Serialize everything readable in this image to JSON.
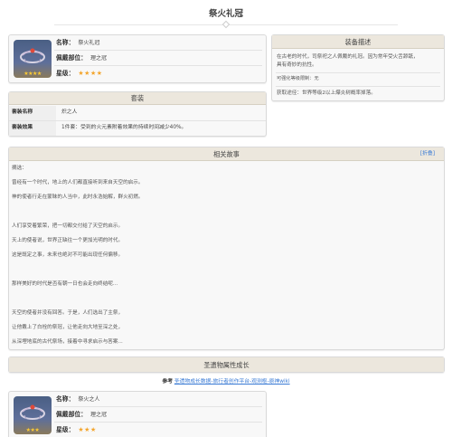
{
  "page": {
    "title": "祭火礼冠"
  },
  "item": {
    "name_label": "名称：",
    "name_value": "祭火礼冠",
    "slot_label": "佩戴部位：",
    "slot_value": "理之冠",
    "rarity_label": "星级：",
    "rarity_stars": "★★★★",
    "icon_stars": "★★★★",
    "icon": "crown-relic-icon"
  },
  "description": {
    "header": "装备描述",
    "text_1": "在古老的时代，司祭祀之人佩戴的礼冠。因为常年受火舌舔舐，",
    "text_2": "具有奇妙的抗性。",
    "max_enhance": "可强化等级限制：无",
    "source": "获取途径：世界等级2以上爆炎树概率掉落。"
  },
  "set": {
    "header": "套装",
    "name_key": "套装名称",
    "name_value": "炽之人",
    "effect_key": "套装效果",
    "effect_value": "1件套：受到的火元素附着效果的持续时间减少40%。"
  },
  "story": {
    "header": "相关故事",
    "edit": "[折叠]",
    "lines": [
      "摘选：",
      "曾经有一个时代，地上的人们都直接听到来自天空的启示。",
      "神的使者行走在蒙昧的人当中，此时永浩始解，群火初燃。",
      "",
      "人们享受着繁荣，把一切都交付给了天空的启示。",
      "天上的使者说，世界正缺往一个更加光明的时代。",
      "这是既定之事，未来也绝对不可能出现任何偏移。",
      "",
      "那样美好的时代是否有朝一日也会走向终结呢...",
      "",
      "天空的使者并没有回答。于是，人们选出了主祭，",
      "让他戴上了白栓的祭冠，让他走向大地至深之处，",
      "从深埋地底的古代祭场，接着中寻求启示与答案..."
    ]
  },
  "growth": {
    "header": "圣遗物属性成长",
    "ref_label": "参考",
    "ref_links": "圣遗物成长数据-旅行者创作平台-观测枢-原神wiki"
  },
  "item2": {
    "name_label": "名称：",
    "name_value": "祭火之人",
    "slot_label": "佩戴部位：",
    "slot_value": "理之冠",
    "rarity_label": "星级：",
    "rarity_stars": "★★★",
    "icon_stars": "★★★",
    "icon": "crown-relic-icon"
  },
  "colors": {
    "link": "#3a7bd5",
    "star": "#f3a52c",
    "header_bg": "#ece7dd"
  }
}
